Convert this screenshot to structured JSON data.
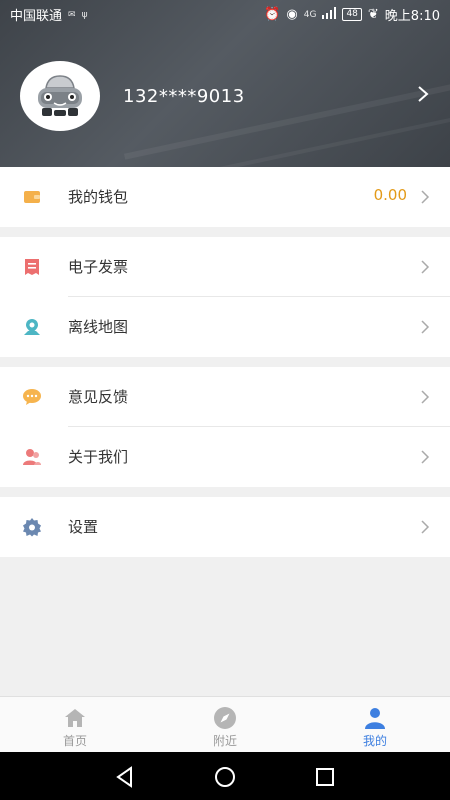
{
  "status": {
    "carrier": "中国联通",
    "network": "4G",
    "battery": "48",
    "time": "晚上8:10"
  },
  "profile": {
    "phone": "132****9013"
  },
  "menu": {
    "wallet": {
      "label": "我的钱包",
      "value": "0.00"
    },
    "invoice": {
      "label": "电子发票"
    },
    "offline_map": {
      "label": "离线地图"
    },
    "feedback": {
      "label": "意见反馈"
    },
    "about": {
      "label": "关于我们"
    },
    "settings": {
      "label": "设置"
    }
  },
  "tabs": [
    {
      "label": "首页",
      "icon": "home-icon"
    },
    {
      "label": "附近",
      "icon": "compass-icon"
    },
    {
      "label": "我的",
      "icon": "person-icon"
    }
  ],
  "colors": {
    "accent": "#3d7fe0",
    "wallet_value": "#e39a18",
    "header_bg": "#4a5057"
  }
}
